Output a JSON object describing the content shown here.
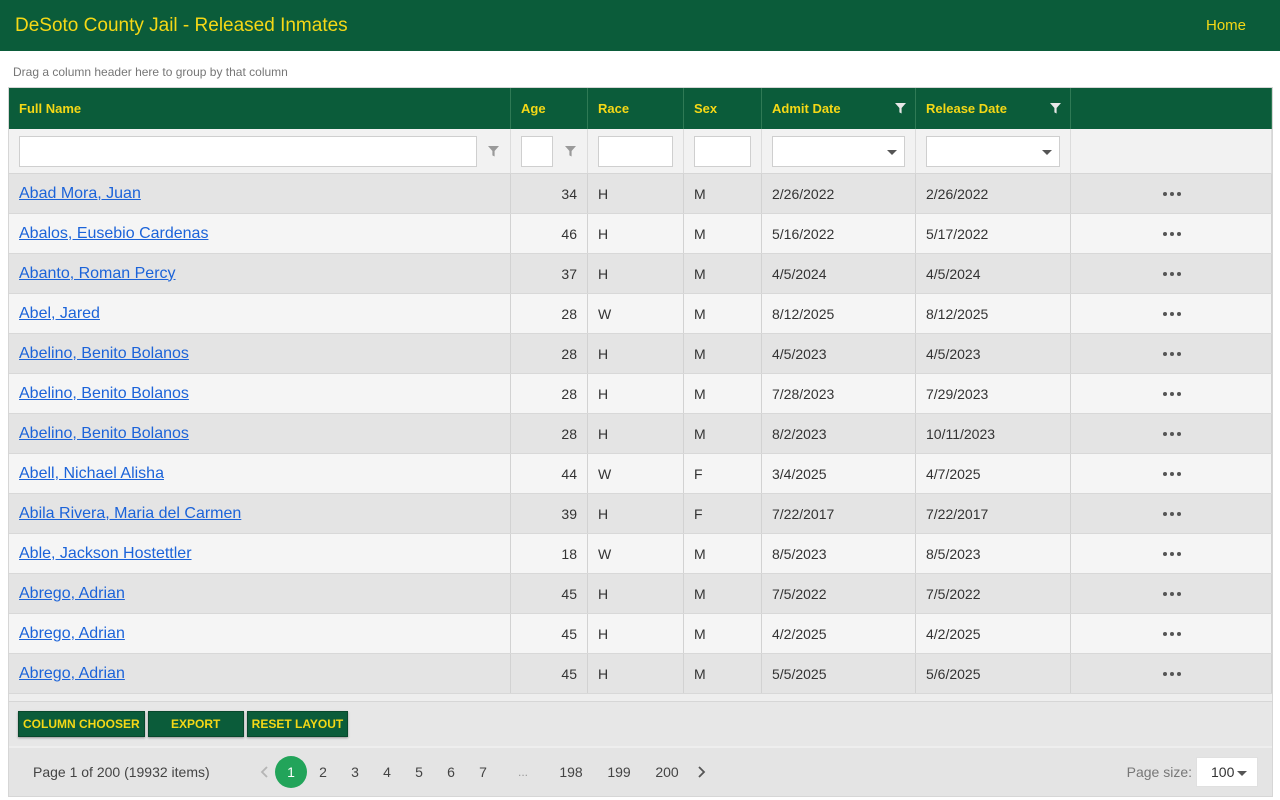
{
  "app": {
    "title": "DeSoto County Jail - Released Inmates",
    "nav_home": "Home"
  },
  "grid": {
    "group_panel_hint": "Drag a column header here to group by that column",
    "columns": {
      "full_name": "Full Name",
      "age": "Age",
      "race": "Race",
      "sex": "Sex",
      "admit_date": "Admit Date",
      "release_date": "Release Date"
    },
    "rows": [
      {
        "name": "Abad Mora, Juan",
        "age": "34",
        "race": "H",
        "sex": "M",
        "admit": "2/26/2022",
        "release": "2/26/2022"
      },
      {
        "name": "Abalos, Eusebio Cardenas",
        "age": "46",
        "race": "H",
        "sex": "M",
        "admit": "5/16/2022",
        "release": "5/17/2022"
      },
      {
        "name": "Abanto, Roman Percy",
        "age": "37",
        "race": "H",
        "sex": "M",
        "admit": "4/5/2024",
        "release": "4/5/2024"
      },
      {
        "name": "Abel, Jared",
        "age": "28",
        "race": "W",
        "sex": "M",
        "admit": "8/12/2025",
        "release": "8/12/2025"
      },
      {
        "name": "Abelino, Benito Bolanos",
        "age": "28",
        "race": "H",
        "sex": "M",
        "admit": "4/5/2023",
        "release": "4/5/2023"
      },
      {
        "name": "Abelino, Benito Bolanos",
        "age": "28",
        "race": "H",
        "sex": "M",
        "admit": "7/28/2023",
        "release": "7/29/2023"
      },
      {
        "name": "Abelino, Benito Bolanos",
        "age": "28",
        "race": "H",
        "sex": "M",
        "admit": "8/2/2023",
        "release": "10/11/2023"
      },
      {
        "name": "Abell, Nichael Alisha",
        "age": "44",
        "race": "W",
        "sex": "F",
        "admit": "3/4/2025",
        "release": "4/7/2025"
      },
      {
        "name": "Abila Rivera, Maria del Carmen",
        "age": "39",
        "race": "H",
        "sex": "F",
        "admit": "7/22/2017",
        "release": "7/22/2017"
      },
      {
        "name": "Able, Jackson Hostettler",
        "age": "18",
        "race": "W",
        "sex": "M",
        "admit": "8/5/2023",
        "release": "8/5/2023"
      },
      {
        "name": "Abrego, Adrian",
        "age": "45",
        "race": "H",
        "sex": "M",
        "admit": "7/5/2022",
        "release": "7/5/2022"
      },
      {
        "name": "Abrego, Adrian",
        "age": "45",
        "race": "H",
        "sex": "M",
        "admit": "4/2/2025",
        "release": "4/2/2025"
      },
      {
        "name": "Abrego, Adrian",
        "age": "45",
        "race": "H",
        "sex": "M",
        "admit": "5/5/2025",
        "release": "5/6/2025"
      }
    ],
    "toolbar": {
      "column_chooser": "COLUMN CHOOSER",
      "export": "EXPORT",
      "reset_layout": "RESET LAYOUT"
    },
    "pager": {
      "info": "Page 1 of 200 (19932 items)",
      "pages": [
        "1",
        "2",
        "3",
        "4",
        "5",
        "6",
        "7",
        "...",
        "198",
        "199",
        "200"
      ],
      "current_page": "1",
      "page_size_label": "Page size:",
      "page_size": "100"
    }
  },
  "colors": {
    "brand_green": "#0b5c3a",
    "brand_yellow": "#f5d816",
    "link_blue": "#1b63d9",
    "active_page": "#22a45a"
  },
  "icons": {
    "column_filter": "filter-icon",
    "row_actions": "more-horizontal-icon",
    "pager_prev": "chevron-left-icon",
    "pager_next": "chevron-right-icon",
    "dropdown": "caret-down-icon"
  }
}
